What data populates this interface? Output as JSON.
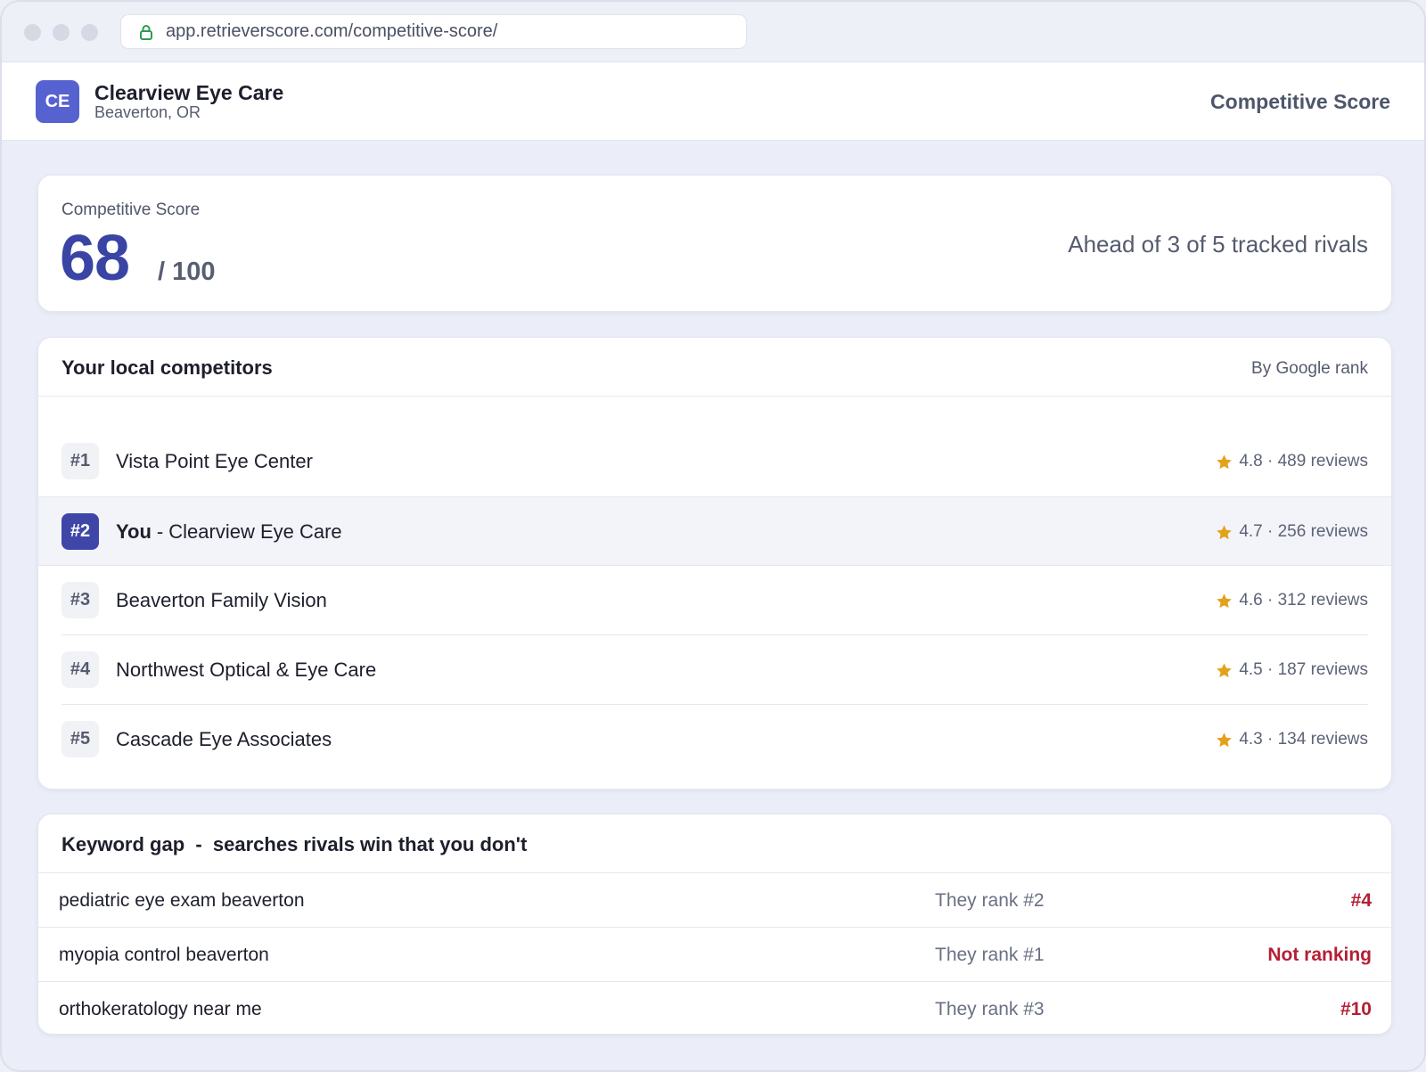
{
  "browser": {
    "url": "app.retrieverscore.com/competitive-score/"
  },
  "header": {
    "avatar_initials": "CE",
    "business_name": "Clearview Eye Care",
    "business_location": "Beaverton, OR",
    "page_title": "Competitive Score"
  },
  "score": {
    "label": "Competitive Score",
    "value": "68",
    "max": "/ 100",
    "summary": "Ahead of 3 of 5 tracked rivals"
  },
  "competitors": {
    "title": "Your local competitors",
    "sort_label": "By Google rank",
    "items": [
      {
        "rank": "#1",
        "name": "Vista Point Eye Center",
        "rating": "4.8 · 489 reviews"
      },
      {
        "rank": "#2",
        "you_label": "You",
        "separator": "-",
        "name": "Clearview Eye Care",
        "rating": "4.7 · 256 reviews"
      },
      {
        "rank": "#3",
        "name": "Beaverton Family Vision",
        "rating": "4.6 · 312 reviews"
      },
      {
        "rank": "#4",
        "name": "Northwest Optical & Eye Care",
        "rating": "4.5 · 187 reviews"
      },
      {
        "rank": "#5",
        "name": "Cascade Eye Associates",
        "rating": "4.3 · 134 reviews"
      }
    ]
  },
  "keyword_gap": {
    "title": "Keyword gap  -  searches rivals win that you don't",
    "rows": [
      {
        "keyword": "pediatric eye exam beaverton",
        "their_rank": "They rank #2",
        "your_rank": "#4"
      },
      {
        "keyword": "myopia control beaverton",
        "their_rank": "They rank #1",
        "your_rank": "Not ranking"
      },
      {
        "keyword": "orthokeratology near me",
        "their_rank": "They rank #3",
        "your_rank": "#10"
      }
    ]
  },
  "colors": {
    "accent": "#3e47a8",
    "star": "#e3a21a",
    "negative": "#b41f35"
  },
  "icons": {
    "lock": "lock-icon",
    "star": "star-icon"
  }
}
